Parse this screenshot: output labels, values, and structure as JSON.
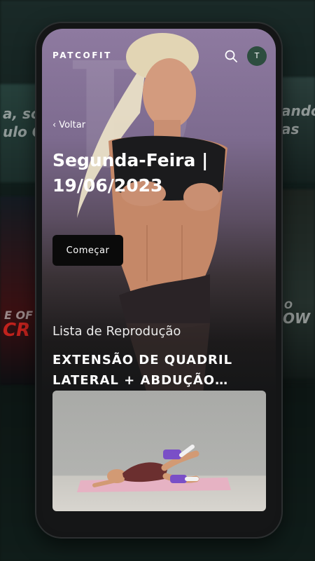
{
  "app": {
    "brand": "PATCOFIT",
    "avatar_initial": "T"
  },
  "navigation": {
    "back_label": "Voltar",
    "back_chevron": "‹"
  },
  "workout": {
    "title_line1": "Segunda-Feira |",
    "title_line2": "19/06/2023",
    "start_button": "Começar"
  },
  "playlist": {
    "section_label": "Lista de Reprodução",
    "current_title_line1": "EXTENSÃO DE QUADRIL",
    "current_title_line2": "LATERAL + ABDUÇÃO…"
  },
  "background_text": {
    "left_line1": "a, sou",
    "left_line2": "ulo Co",
    "right_line1": "ando",
    "right_line2": "as",
    "red_line1": "E OF",
    "red_line2": "CR",
    "right_low_line1": "O",
    "right_low_line2": "OW"
  },
  "icons": {
    "search": "search-icon",
    "back": "chevron-left-icon",
    "avatar": "user-avatar"
  },
  "colors": {
    "accent": "#2d4d3f",
    "hero_top": "#8e7aa0",
    "button_bg": "#0a0a0a",
    "screen_bg": "#151617"
  }
}
